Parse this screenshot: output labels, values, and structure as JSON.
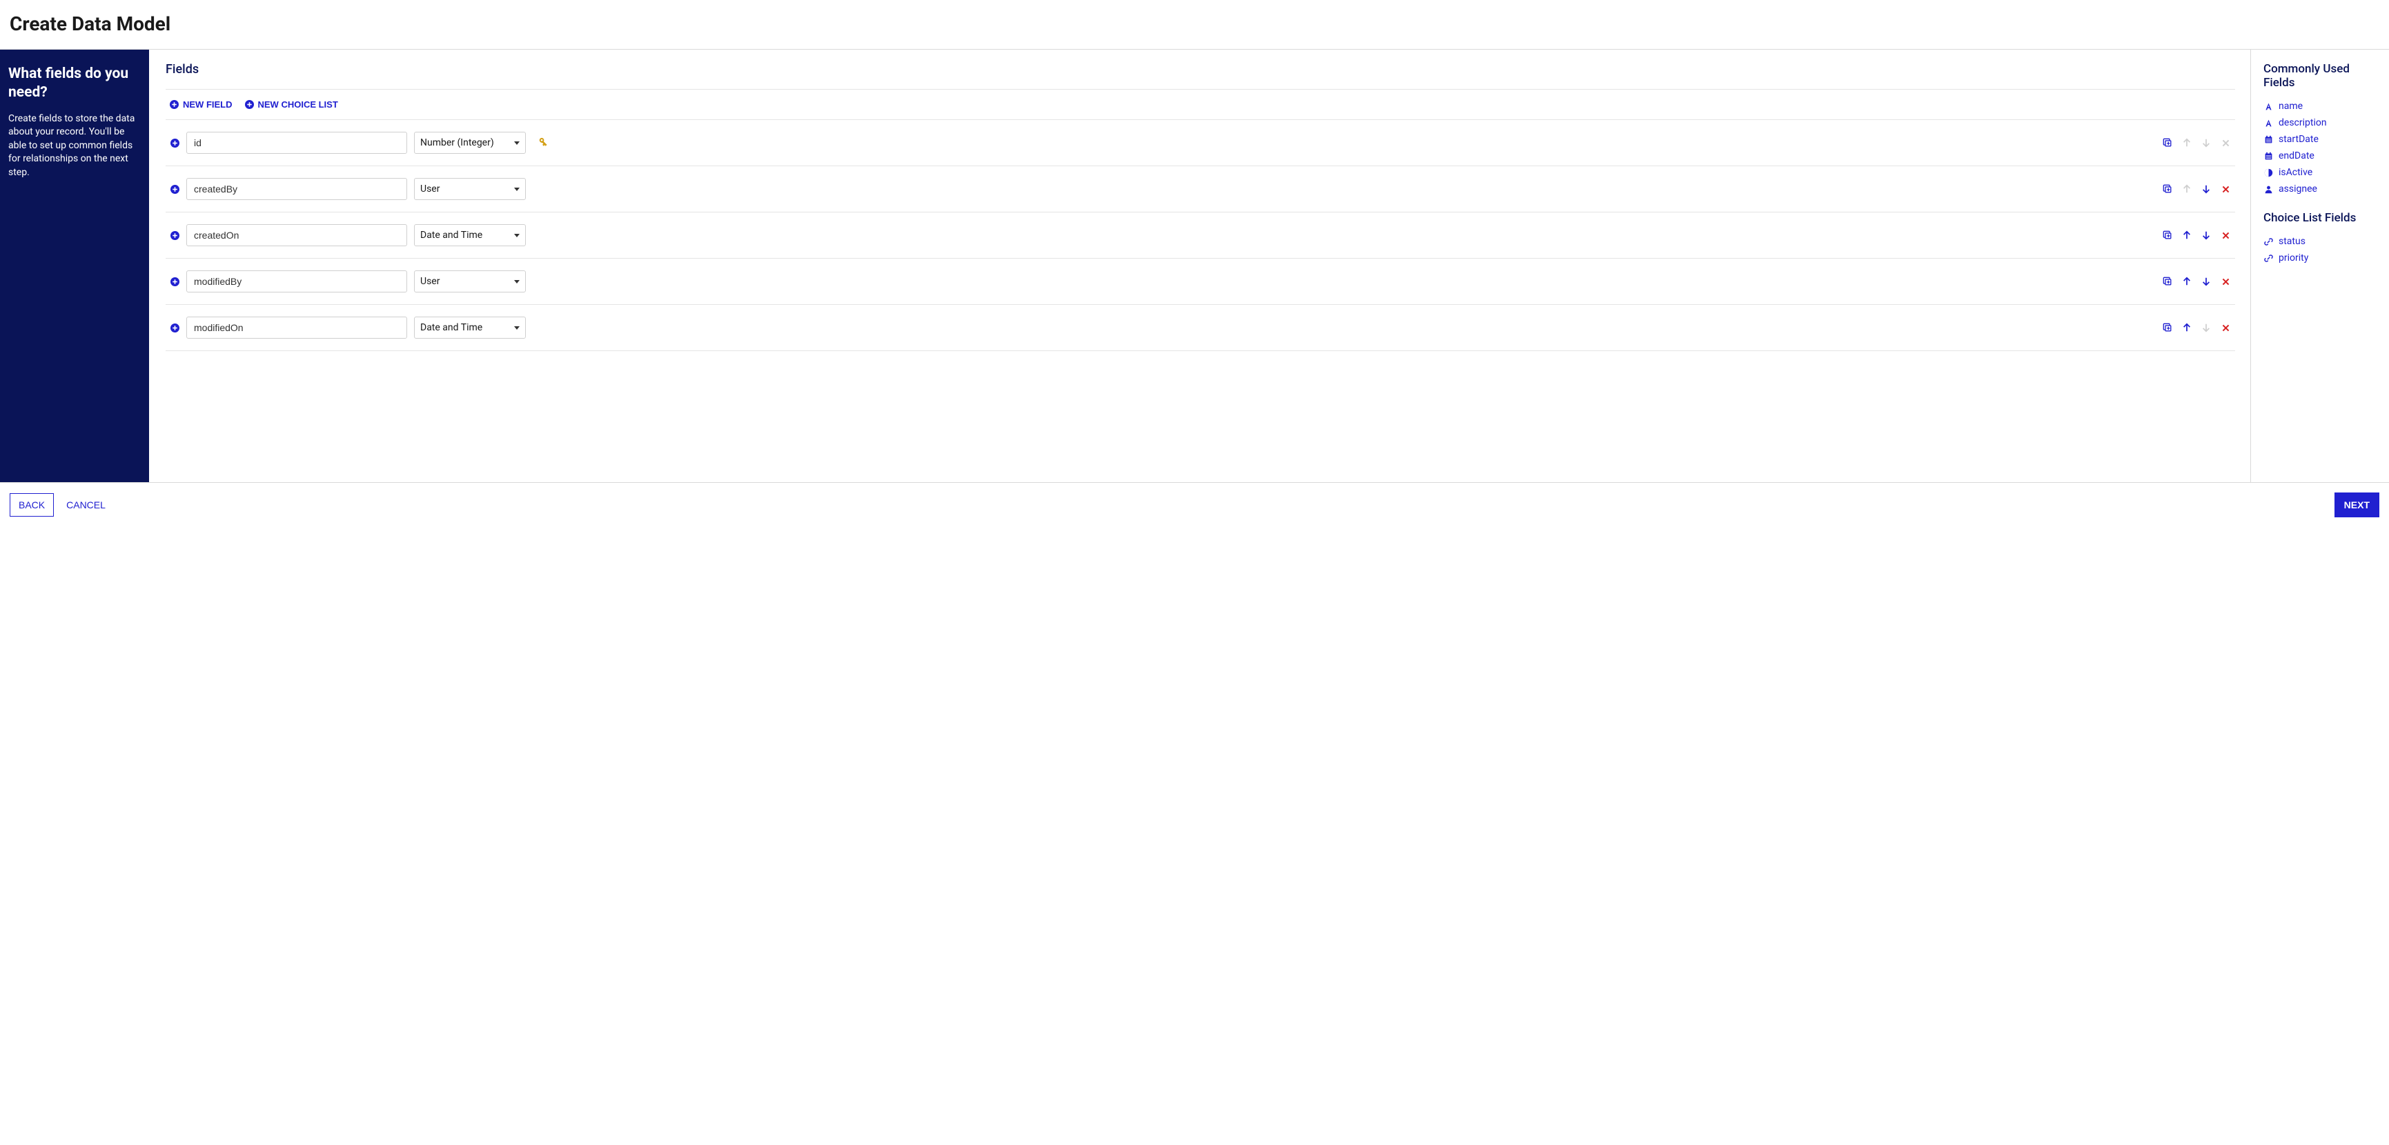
{
  "page": {
    "title": "Create Data Model"
  },
  "sidebar": {
    "title": "What fields do you need?",
    "description": "Create fields to store the data about your record. You'll be able to set up common fields for relationships on the next step."
  },
  "main": {
    "title": "Fields",
    "toolbar": {
      "new_field": "NEW FIELD",
      "new_choice_list": "NEW CHOICE LIST"
    },
    "fields": [
      {
        "name": "id",
        "type": "Number (Integer)",
        "primaryKey": true,
        "upEnabled": false,
        "downEnabled": false,
        "deleteEnabled": false
      },
      {
        "name": "createdBy",
        "type": "User",
        "primaryKey": false,
        "upEnabled": false,
        "downEnabled": true,
        "deleteEnabled": true
      },
      {
        "name": "createdOn",
        "type": "Date and Time",
        "primaryKey": false,
        "upEnabled": true,
        "downEnabled": true,
        "deleteEnabled": true
      },
      {
        "name": "modifiedBy",
        "type": "User",
        "primaryKey": false,
        "upEnabled": true,
        "downEnabled": true,
        "deleteEnabled": true
      },
      {
        "name": "modifiedOn",
        "type": "Date and Time",
        "primaryKey": false,
        "upEnabled": true,
        "downEnabled": false,
        "deleteEnabled": true
      }
    ]
  },
  "right": {
    "common_title": "Commonly Used Fields",
    "common_fields": [
      {
        "icon": "text",
        "label": "name"
      },
      {
        "icon": "text",
        "label": "description"
      },
      {
        "icon": "calendar",
        "label": "startDate"
      },
      {
        "icon": "calendar",
        "label": "endDate"
      },
      {
        "icon": "boolean",
        "label": "isActive"
      },
      {
        "icon": "user",
        "label": "assignee"
      }
    ],
    "choice_title": "Choice List Fields",
    "choice_fields": [
      {
        "icon": "link",
        "label": "status"
      },
      {
        "icon": "link",
        "label": "priority"
      }
    ]
  },
  "footer": {
    "back": "BACK",
    "cancel": "CANCEL",
    "next": "NEXT"
  }
}
